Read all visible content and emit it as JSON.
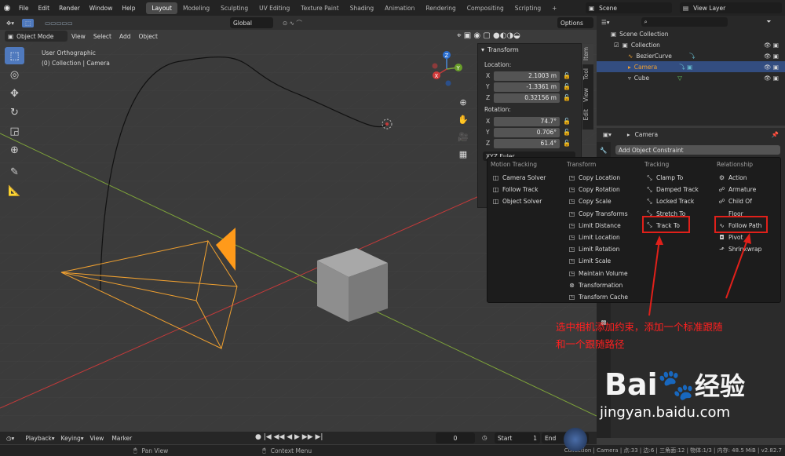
{
  "topbar": {
    "menus": [
      "File",
      "Edit",
      "Render",
      "Window",
      "Help"
    ],
    "workspaces": [
      "Layout",
      "Modeling",
      "Sculpting",
      "UV Editing",
      "Texture Paint",
      "Shading",
      "Animation",
      "Rendering",
      "Compositing",
      "Scripting"
    ],
    "active_workspace": "Layout",
    "plus": "+",
    "scene": "Scene",
    "view_layer": "View Layer"
  },
  "viewport": {
    "mode": "Object Mode",
    "menus": [
      "View",
      "Select",
      "Add",
      "Object"
    ],
    "orientation": "Global",
    "options": "Options",
    "overlay_line1": "User Orthographic",
    "overlay_line2": "(0) Collection | Camera",
    "gizmo": {
      "x": "X",
      "y": "Y",
      "z": "Z"
    }
  },
  "npanel": {
    "header": "Transform",
    "location_label": "Location:",
    "location": [
      {
        "axis": "X",
        "value": "2.1003 m"
      },
      {
        "axis": "Y",
        "value": "-1.3361 m"
      },
      {
        "axis": "Z",
        "value": "0.32156 m"
      }
    ],
    "rotation_label": "Rotation:",
    "rotation": [
      {
        "axis": "X",
        "value": "74.7°"
      },
      {
        "axis": "Y",
        "value": "0.706°"
      },
      {
        "axis": "Z",
        "value": "61.4°"
      }
    ],
    "rotation_mode": "XYZ Euler",
    "tabs": [
      "Item",
      "Tool",
      "View",
      "Edit"
    ]
  },
  "outliner": {
    "search_placeholder": "",
    "items": [
      {
        "label": "Scene Collection"
      },
      {
        "label": "Collection"
      },
      {
        "label": "BezierCurve"
      },
      {
        "label": "Camera"
      },
      {
        "label": "Cube"
      }
    ]
  },
  "properties": {
    "object_name": "Camera",
    "add_constraint": "Add Object Constraint"
  },
  "constraint_menu": {
    "columns": [
      {
        "title": "Motion Tracking",
        "items": [
          "Camera Solver",
          "Follow Track",
          "Object Solver"
        ]
      },
      {
        "title": "Transform",
        "items": [
          "Copy Location",
          "Copy Rotation",
          "Copy Scale",
          "Copy Transforms",
          "Limit Distance",
          "Limit Location",
          "Limit Rotation",
          "Limit Scale",
          "Maintain Volume",
          "Transformation",
          "Transform Cache"
        ]
      },
      {
        "title": "Tracking",
        "items": [
          "Clamp To",
          "Damped Track",
          "Locked Track",
          "Stretch To",
          "Track To"
        ]
      },
      {
        "title": "Relationship",
        "items": [
          "Action",
          "Armature",
          "Child Of",
          "Floor",
          "Follow Path",
          "Pivot",
          "Shrinkwrap"
        ]
      }
    ]
  },
  "annotation": {
    "line1": "选中相机添加约束，添加一个标准跟随",
    "line2": "和一个跟随路径"
  },
  "timeline": {
    "menus": [
      "Playback",
      "Keying",
      "View",
      "Marker"
    ],
    "current_frame": "0",
    "start_label": "Start",
    "start_value": "1",
    "end_label": "End"
  },
  "statusbar": {
    "pan": "Pan View",
    "context": "Context Menu",
    "stats": "Collection | Camera | 点:33 | 边:6 | 三角面:12 | 物体:1/3 | 内存: 48.5 MiB | v2.82.7"
  },
  "watermark": {
    "brand_a": "Bai",
    "brand_b": "经验",
    "url": "jingyan.baidu.com"
  },
  "colors": {
    "accent": "#4f79bd",
    "highlight_box": "#e0201a",
    "camera": "#f0a030",
    "x_axis": "#c43a3a",
    "y_axis": "#7ea33a"
  }
}
